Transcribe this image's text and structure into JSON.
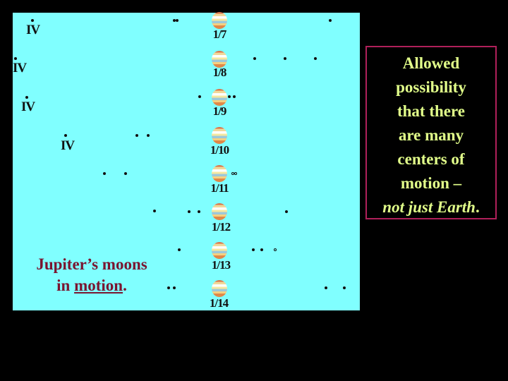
{
  "slide": {
    "title_caption": {
      "line1": "Jupiter’s moons",
      "line2_prefix": "in ",
      "line2_underlined": "motion",
      "line2_suffix": "."
    },
    "annotation": {
      "lines": [
        "Allowed",
        "possibility",
        "that there",
        "are many",
        "centers of",
        "motion –"
      ],
      "italic_line": "not just Earth",
      "italic_suffix": "."
    },
    "colors": {
      "background": "#000000",
      "panel": "#80FFFF",
      "caption": "#7A1530",
      "annotation_text": "#E2FF8A",
      "annotation_border": "#B0205A"
    }
  },
  "observations": [
    {
      "date": "1/7",
      "roman": "IV"
    },
    {
      "date": "1/8",
      "roman": "IV"
    },
    {
      "date": "1/9",
      "roman": "IV"
    },
    {
      "date": "1/10",
      "roman": "IV"
    },
    {
      "date": "1/11"
    },
    {
      "date": "1/12"
    },
    {
      "date": "1/13"
    },
    {
      "date": "1/14"
    }
  ]
}
